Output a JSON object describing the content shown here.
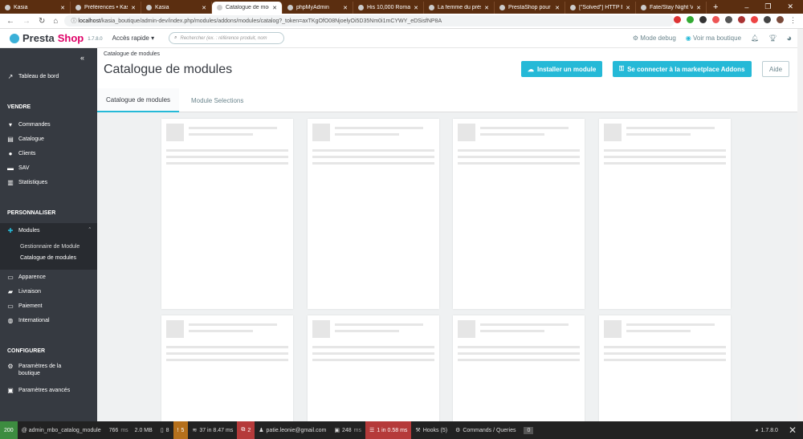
{
  "browser": {
    "tabs": [
      {
        "label": "Kasia",
        "active": false
      },
      {
        "label": "Préférences • Kasia",
        "active": false
      },
      {
        "label": "Kasia",
        "active": false
      },
      {
        "label": "Catalogue de modu",
        "active": true
      },
      {
        "label": "phpMyAdmin",
        "active": false
      },
      {
        "label": "His 10,000 Romanti",
        "active": false
      },
      {
        "label": "La femme du présid",
        "active": false
      },
      {
        "label": "PrestaShop pour le",
        "active": false
      },
      {
        "label": "[\"Solved\"] HTTP ERI",
        "active": false
      },
      {
        "label": "Fate/Stay Night VF",
        "active": false
      }
    ],
    "url_host": "localhost",
    "url_path": "/kasia_boutique/admin-dev/index.php/modules/addons/modules/catalog?_token=axTKgOfO08NjoelyOi5D35Nm0i1mCYWY_eDSisfNP8A"
  },
  "header": {
    "logo_a": "Presta",
    "logo_b": "Shop",
    "version": "1.7.8.0",
    "quick_access": "Accès rapide",
    "search_placeholder": "Rechercher (ex. : référence produit, nom",
    "debug_mode": "Mode debug",
    "view_shop": "Voir ma boutique"
  },
  "sidebar": {
    "dashboard": "Tableau de bord",
    "sell": "VENDRE",
    "orders": "Commandes",
    "catalog": "Catalogue",
    "customers": "Clients",
    "sav": "SAV",
    "stats": "Statistiques",
    "customize": "PERSONNALISER",
    "modules": "Modules",
    "module_manager": "Gestionnaire de Module",
    "module_catalog": "Catalogue de modules",
    "appearance": "Apparence",
    "shipping": "Livraison",
    "payment": "Paiement",
    "international": "International",
    "configure": "CONFIGURER",
    "shop_params": "Paramètres de la boutique",
    "advanced_params": "Paramètres avancés"
  },
  "page": {
    "breadcrumb": "Catalogue de modules",
    "title": "Catalogue de modules",
    "install_button": "Installer un module",
    "connect_button": "Se connecter à la marketplace Addons",
    "help_button": "Aide",
    "tabs": [
      "Catalogue de modules",
      "Module Selections"
    ]
  },
  "debug_bar": {
    "status": "200",
    "route": "@ admin_mbo_catalog_module",
    "time": "766",
    "time_unit": "ms",
    "memory": "2.0 MB",
    "forms": "8",
    "warnings": "5",
    "queries": "37 in 8.47 ms",
    "errors": "2",
    "user": "patie.leonie@gmail.com",
    "load": "248",
    "load_unit": "ms",
    "cache": "1 in 0.58 ms",
    "hooks": "Hooks (5)",
    "commands": "Commands / Queries",
    "count": "0",
    "version": "1.7.8.0"
  },
  "colors": {
    "accent": "#25b9d7",
    "sidebar": "#363a41",
    "tabbar": "#5b2e10"
  }
}
